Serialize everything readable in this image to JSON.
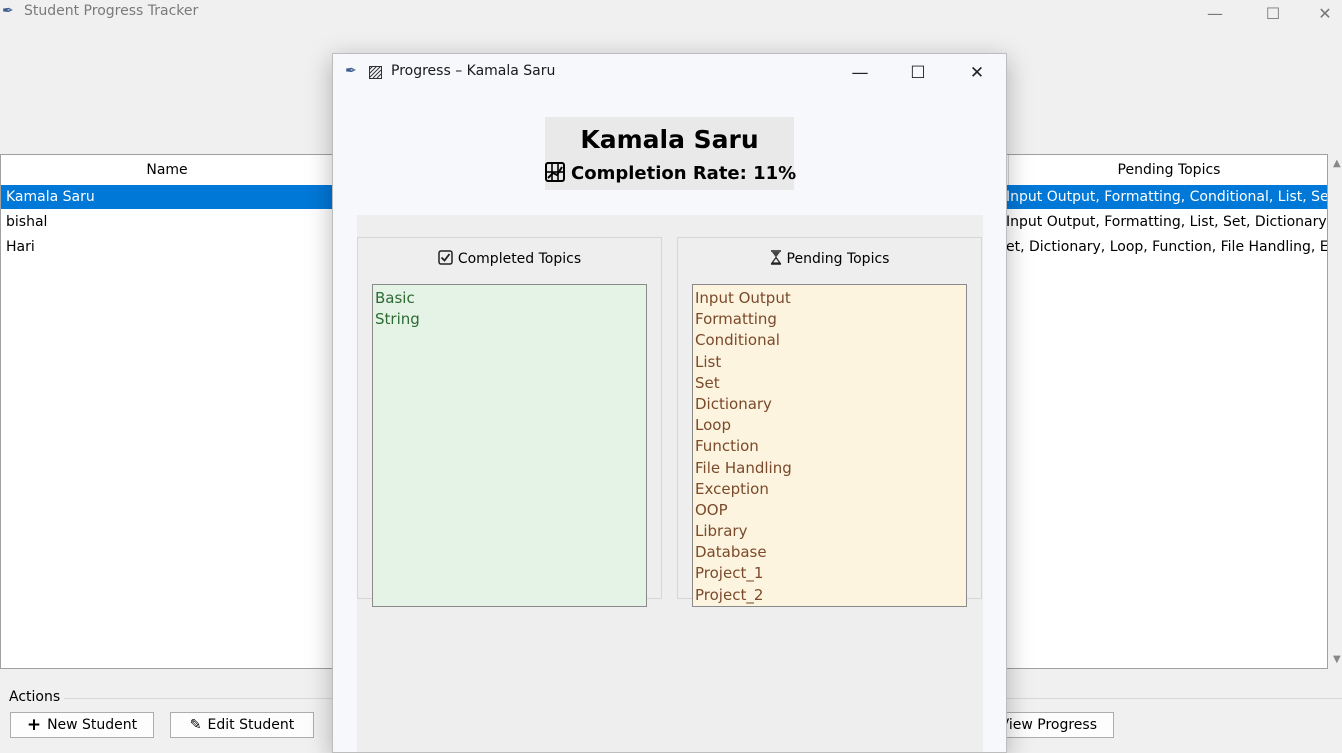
{
  "main_window": {
    "title": "Student Progress Tracker",
    "feather_icon": "feather-icon",
    "controls": {
      "minimize": "—",
      "maximize": "☐",
      "close": "✕"
    }
  },
  "table": {
    "columns": {
      "name": "Name",
      "pending": "Pending Topics"
    },
    "rows": [
      {
        "name": "Kamala Saru",
        "pending": "Input Output, Formatting, Conditional, List, Set, D",
        "selected": true
      },
      {
        "name": "bishal",
        "pending": "Input Output, Formatting, List, Set, Dictionary, Lo",
        "selected": false
      },
      {
        "name": "Hari",
        "pending": "et, Dictionary, Loop, Function, File Handling, Exc",
        "selected": false
      }
    ]
  },
  "actions": {
    "label": "Actions",
    "new_student": "New Student",
    "edit_student": "Edit Student",
    "view_progress": "View Progress"
  },
  "modal": {
    "title": "Progress – Kamala Saru",
    "student_name": "Kamala Saru",
    "completion_label": "Completion Rate: 11%",
    "completion_rate": 0.11,
    "completed_title": "Completed Topics",
    "pending_title": "Pending Topics",
    "completed_topics": [
      "Basic",
      "String"
    ],
    "pending_topics": [
      "Input Output",
      "Formatting",
      "Conditional",
      "List",
      "Set",
      "Dictionary",
      "Loop",
      "Function",
      "File Handling",
      "Exception",
      "OOP",
      "Library",
      "Database",
      "Project_1",
      "Project_2"
    ]
  },
  "colors": {
    "selection": "#0078d7",
    "completed_bg": "#e5f3e7",
    "completed_text": "#2e6b33",
    "pending_bg": "#fdf4df",
    "pending_text": "#7a4a2c"
  }
}
